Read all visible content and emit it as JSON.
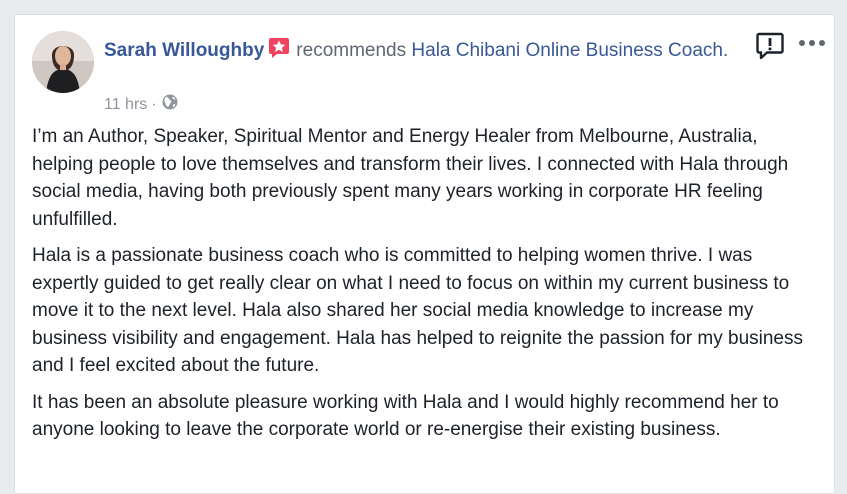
{
  "post": {
    "author": "Sarah Willoughby",
    "badge_icon": "star-badge-icon",
    "verb": "recommends",
    "page_name": "Hala Chibani Online Business Coach.",
    "timestamp": "11 hrs",
    "separator": "·",
    "audience_icon": "globe-icon",
    "paragraphs": [
      "I’m an Author, Speaker, Spiritual Mentor and Energy Healer from Melbourne, Australia, helping people to love themselves and transform their lives. I connected with Hala through social media, having both previously spent many years working in corporate HR feeling unfulfilled.",
      "Hala is a passionate business coach who is committed to helping women thrive. I was expertly guided to get really clear on what I need to focus on within my current business to move it to the next level. Hala also shared her social media knowledge to increase my business visibility and engagement. Hala has helped to reignite the passion for my business and I feel excited about the future.",
      "It has been an absolute pleasure working with Hala and I would highly recommend her to anyone looking to leave the corporate world or re-energise their existing business."
    ]
  },
  "colors": {
    "link": "#385898",
    "badge": "#f3425f",
    "meta": "#90949c",
    "text": "#1d2129"
  }
}
